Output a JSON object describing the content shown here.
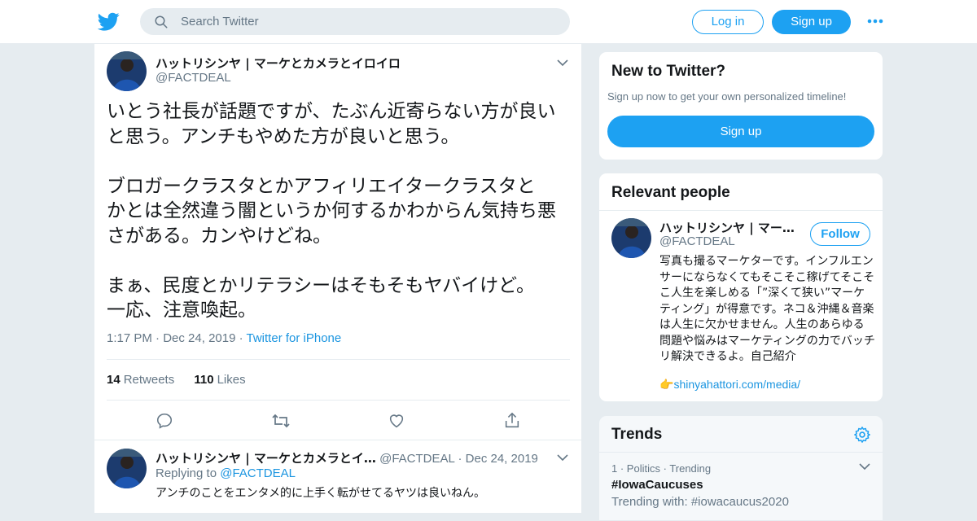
{
  "header": {
    "search_placeholder": "Search Twitter",
    "login_label": "Log in",
    "signup_label": "Sign up",
    "icons": [
      "twitter-bird-icon",
      "search-icon",
      "more-dots-icon"
    ],
    "accent": "#1da1f2"
  },
  "tweet": {
    "name": "ハットリシンヤ | マーケとカメラとイロイロ",
    "handle": "@FACTDEAL",
    "text": "いとう社長が話題ですが、たぶん近寄らない方が良い\nと思う。アンチもやめた方が良いと思う。\n\nブロガークラスタとかアフィリエイタークラスタと\nかとは全然違う闇というか何するかわからん気持ち悪\nさがある。カンやけどね。\n\nまぁ、民度とかリテラシーはそもそもヤバイけど。\n一応、注意喚起。",
    "time": "1:17 PM",
    "date": "Dec 24, 2019",
    "source": "Twitter for iPhone",
    "retweets_count": "14",
    "retweets_label": "Retweets",
    "likes_count": "110",
    "likes_label": "Likes",
    "action_icons": [
      "reply-icon",
      "retweet-icon",
      "like-heart-icon",
      "share-icon"
    ]
  },
  "reply": {
    "name": "ハットリシンヤ | マーケとカメラとイ…",
    "handle": "@FACTDEAL",
    "date": "Dec 24, 2019",
    "replying_label": "Replying to",
    "replying_to": "@FACTDEAL",
    "text": "アンチのことをエンタメ的に上手く転がせてるヤツは良いねん。"
  },
  "new_to_twitter": {
    "title": "New to Twitter?",
    "subtitle": "Sign up now to get your own personalized timeline!",
    "signup_label": "Sign up"
  },
  "relevant_people": {
    "title": "Relevant people",
    "name": "ハットリシンヤ | マー…",
    "handle": "@FACTDEAL",
    "follow_label": "Follow",
    "bio": "写真も撮るマーケターです。インフルエンサーにならなくてもそこそこ稼げてそこそこ人生を楽しめる「”深くて狭い”マーケティング」が得意です。ネコ＆沖縄＆音楽は人生に欠かせません。人生のあらゆる問題や悩みはマーケティングの力でバッチリ解決できるよ。自己紹介",
    "link_emoji": "👉",
    "link": "shinyahattori.com/media/"
  },
  "trends": {
    "title": "Trends",
    "items": [
      {
        "rank": "1",
        "category": "Politics",
        "status": "Trending",
        "name": "#IowaCaucuses",
        "with": "Trending with: #iowacaucus2020"
      }
    ]
  }
}
